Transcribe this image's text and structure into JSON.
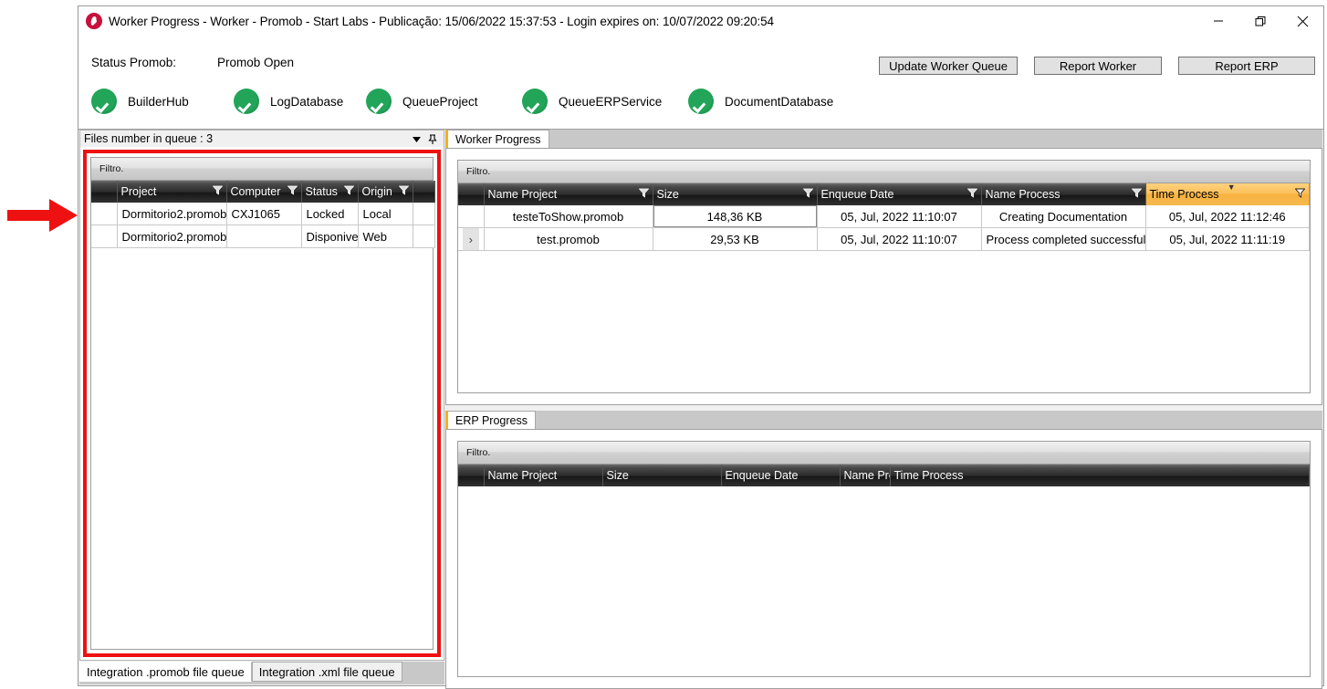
{
  "window": {
    "title": "Worker Progress  -  Worker - Promob  -  Start Labs  -  Publicação: 15/06/2022 15:37:53 - Login expires on: 10/07/2022 09:20:54",
    "icon": "promob-app-icon",
    "controls": {
      "minimize": "minimize-icon",
      "maximize": "restore-icon",
      "close": "close-icon"
    }
  },
  "toolbar": {
    "status_label": "Status Promob:",
    "status_value": "Promob Open",
    "buttons": [
      {
        "label": "Update Worker Queue",
        "name": "update-worker-queue-button"
      },
      {
        "label": "Report Worker",
        "name": "report-worker-button"
      },
      {
        "label": "Report ERP",
        "name": "report-erp-button"
      }
    ],
    "services": [
      {
        "label": "BuilderHub",
        "status": "ok"
      },
      {
        "label": "LogDatabase",
        "status": "ok"
      },
      {
        "label": "QueueProject",
        "status": "ok"
      },
      {
        "label": "QueueERPService",
        "status": "ok"
      },
      {
        "label": "DocumentDatabase",
        "status": "ok"
      }
    ]
  },
  "left_dock": {
    "header": "Files number in queue : 3",
    "dropdown_icon": "chevron-down-icon",
    "pin_icon": "pin-icon",
    "filter_text": "Filtro.",
    "columns": [
      "Project",
      "Computer",
      "Status",
      "Origin"
    ],
    "rows": [
      {
        "project": "Dormitorio2.promob",
        "computer": "CXJ1065",
        "status": "Locked",
        "origin": "Local"
      },
      {
        "project": "Dormitorio2.promob",
        "computer": "",
        "status": "Disponivel",
        "origin": "Web"
      }
    ],
    "bottom_tabs": [
      {
        "label": "Integration .promob file queue",
        "selected": true
      },
      {
        "label": "Integration .xml file queue",
        "selected": false
      }
    ]
  },
  "worker_progress": {
    "tab_label": "Worker Progress",
    "filter_text": "Filtro.",
    "columns": [
      "Name Project",
      "Size",
      "Enqueue Date",
      "Name Process",
      "Time Process"
    ],
    "sorted_column": "Time Process",
    "sort_direction": "asc",
    "rows": [
      {
        "name_project": "testeToShow.promob",
        "size": "148,36 KB",
        "enqueue_date": "05, Jul, 2022 11:10:07",
        "name_process": "Creating Documentation",
        "time_process": "05, Jul, 2022 11:12:46",
        "expander": ""
      },
      {
        "name_project": "test.promob",
        "size": "29,53 KB",
        "enqueue_date": "05, Jul, 2022 11:10:07",
        "name_process": "Process completed successfully",
        "time_process": "05, Jul, 2022 11:11:19",
        "expander": "›"
      }
    ]
  },
  "erp_progress": {
    "tab_label": "ERP Progress",
    "filter_text": "Filtro.",
    "columns": [
      "Name Project",
      "Size",
      "Enqueue Date",
      "Name Process",
      "Time Process"
    ],
    "rows": []
  },
  "annotation": {
    "arrow": "red-arrow-pointer",
    "highlight": "red-highlight-box"
  },
  "colors": {
    "accent_orange": "#f5b01a",
    "sorted_header": "#f7b23f",
    "service_ok": "#22a559",
    "annotation_red": "#ee1111",
    "header_dark": "#2a2a2a"
  }
}
